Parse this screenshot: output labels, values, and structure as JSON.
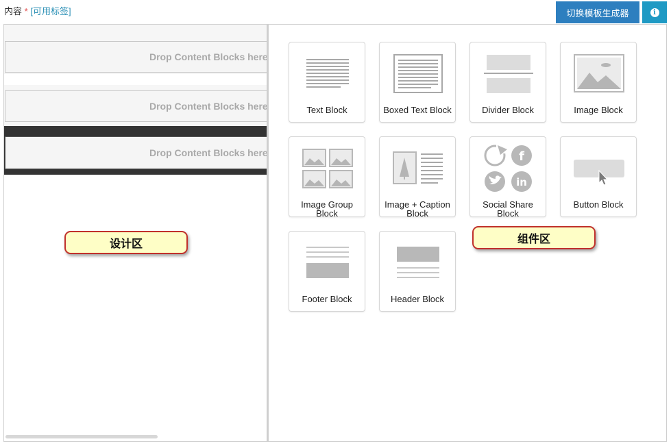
{
  "field": {
    "label": "内容",
    "required_mark": "*",
    "tags_link": "[可用标签]"
  },
  "toolbar": {
    "switch_label": "切换模板生成器",
    "info_icon": "info-icon"
  },
  "design": {
    "drop_text": "Drop Content Blocks here",
    "rows": [
      {
        "style": "light",
        "drop_text": "Drop Content Blocks here"
      },
      {
        "style": "light",
        "drop_text": "Drop Content Blocks here"
      },
      {
        "style": "dark",
        "drop_text": "Drop Content Blocks here"
      }
    ]
  },
  "callouts": {
    "design_area": "设计区",
    "component_area": "组件区"
  },
  "blocks": [
    {
      "label": "Text Block",
      "icon": "text-block-icon"
    },
    {
      "label": "Boxed Text Block",
      "icon": "boxed-text-block-icon"
    },
    {
      "label": "Divider Block",
      "icon": "divider-block-icon"
    },
    {
      "label": "Image Block",
      "icon": "image-block-icon"
    },
    {
      "label": "Image Group Block",
      "icon": "image-group-block-icon"
    },
    {
      "label": "Image + Caption Block",
      "icon": "image-caption-block-icon"
    },
    {
      "label": "Social Share Block",
      "icon": "social-share-block-icon"
    },
    {
      "label": "Button Block",
      "icon": "button-block-icon"
    },
    {
      "label": "Footer Block",
      "icon": "footer-block-icon"
    },
    {
      "label": "Header Block",
      "icon": "header-block-icon"
    }
  ],
  "colors": {
    "primary_button": "#2d7fbf",
    "info_button": "#1f9ac4",
    "callout_bg": "#fefec6",
    "callout_border": "#c0302b"
  }
}
